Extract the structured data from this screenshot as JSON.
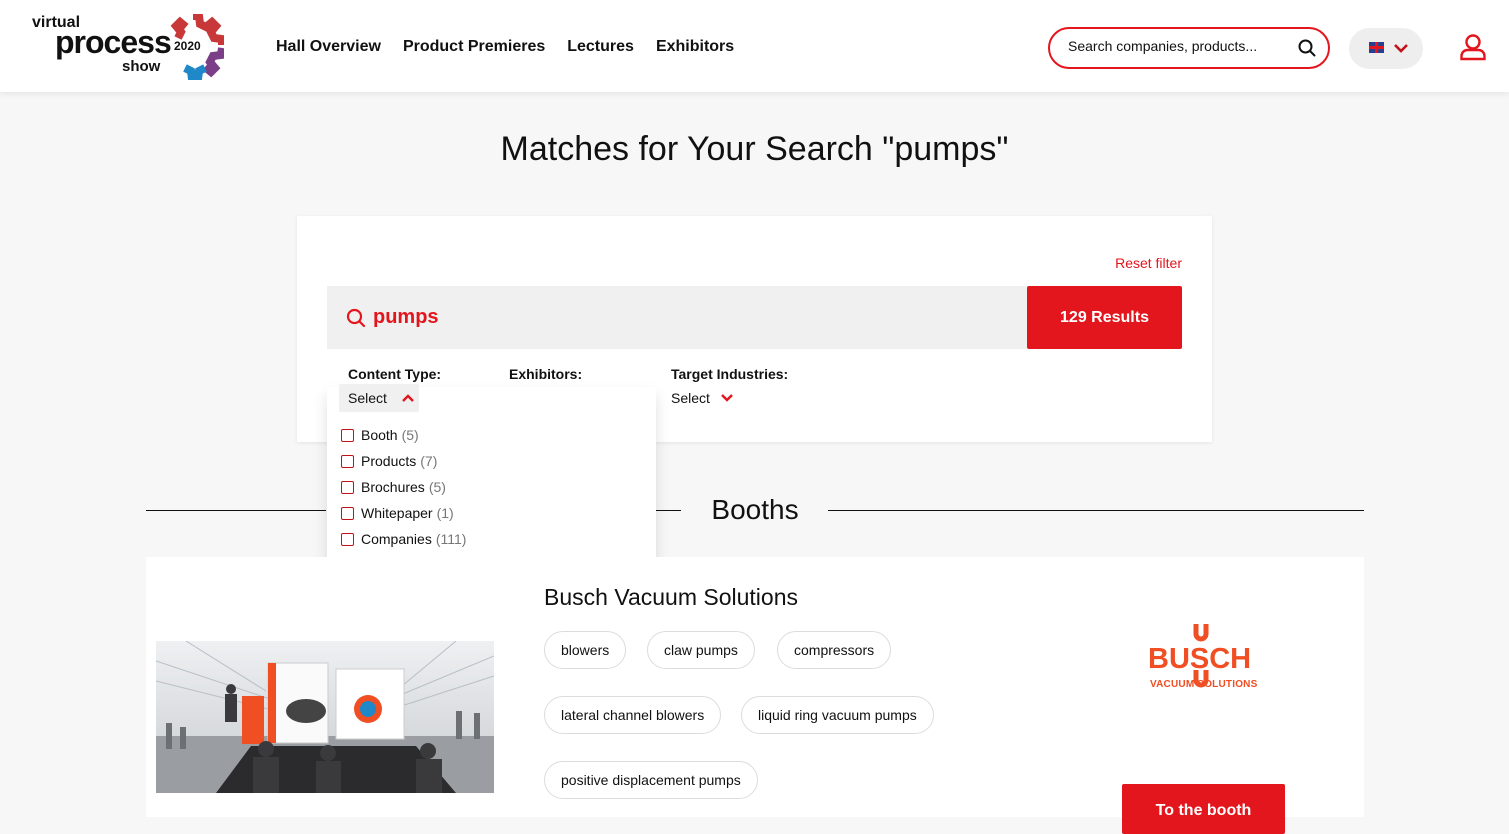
{
  "brand": {
    "line1": "virtual",
    "line2": "process",
    "line3": "show",
    "year": "2020",
    "accent": "#e3161e"
  },
  "nav": {
    "items": [
      "Hall Overview",
      "Product Premieres",
      "Lectures",
      "Exhibitors"
    ]
  },
  "header_search": {
    "placeholder": "Search companies, products...",
    "icon": "search-icon"
  },
  "language": {
    "icon": "uk-flag-icon"
  },
  "page": {
    "title": "Matches for Your Search \"pumps\""
  },
  "search_panel": {
    "reset_label": "Reset filter",
    "query": "pumps",
    "results_label": "129 Results",
    "filters": {
      "content_type": {
        "label": "Content Type:",
        "value": "Select"
      },
      "exhibitors": {
        "label": "Exhibitors:"
      },
      "target_industries": {
        "label": "Target Industries:",
        "value": "Select"
      }
    },
    "content_type_options": [
      {
        "label": "Booth",
        "count": "(5)"
      },
      {
        "label": "Products",
        "count": "(7)"
      },
      {
        "label": "Brochures",
        "count": "(5)"
      },
      {
        "label": "Whitepaper",
        "count": "(1)"
      },
      {
        "label": "Companies",
        "count": "(111)"
      }
    ]
  },
  "booths": {
    "heading": "Booths",
    "items": [
      {
        "company": "Busch Vacuum Solutions",
        "tags": [
          "blowers",
          "claw pumps",
          "compressors",
          "lateral channel blowers",
          "liquid ring vacuum pumps",
          "positive displacement pumps"
        ],
        "logo_text": "BUSCH",
        "logo_sub": "VACUUM SOLUTIONS",
        "logo_color": "#f04e23",
        "button_label": "To the booth"
      }
    ]
  }
}
